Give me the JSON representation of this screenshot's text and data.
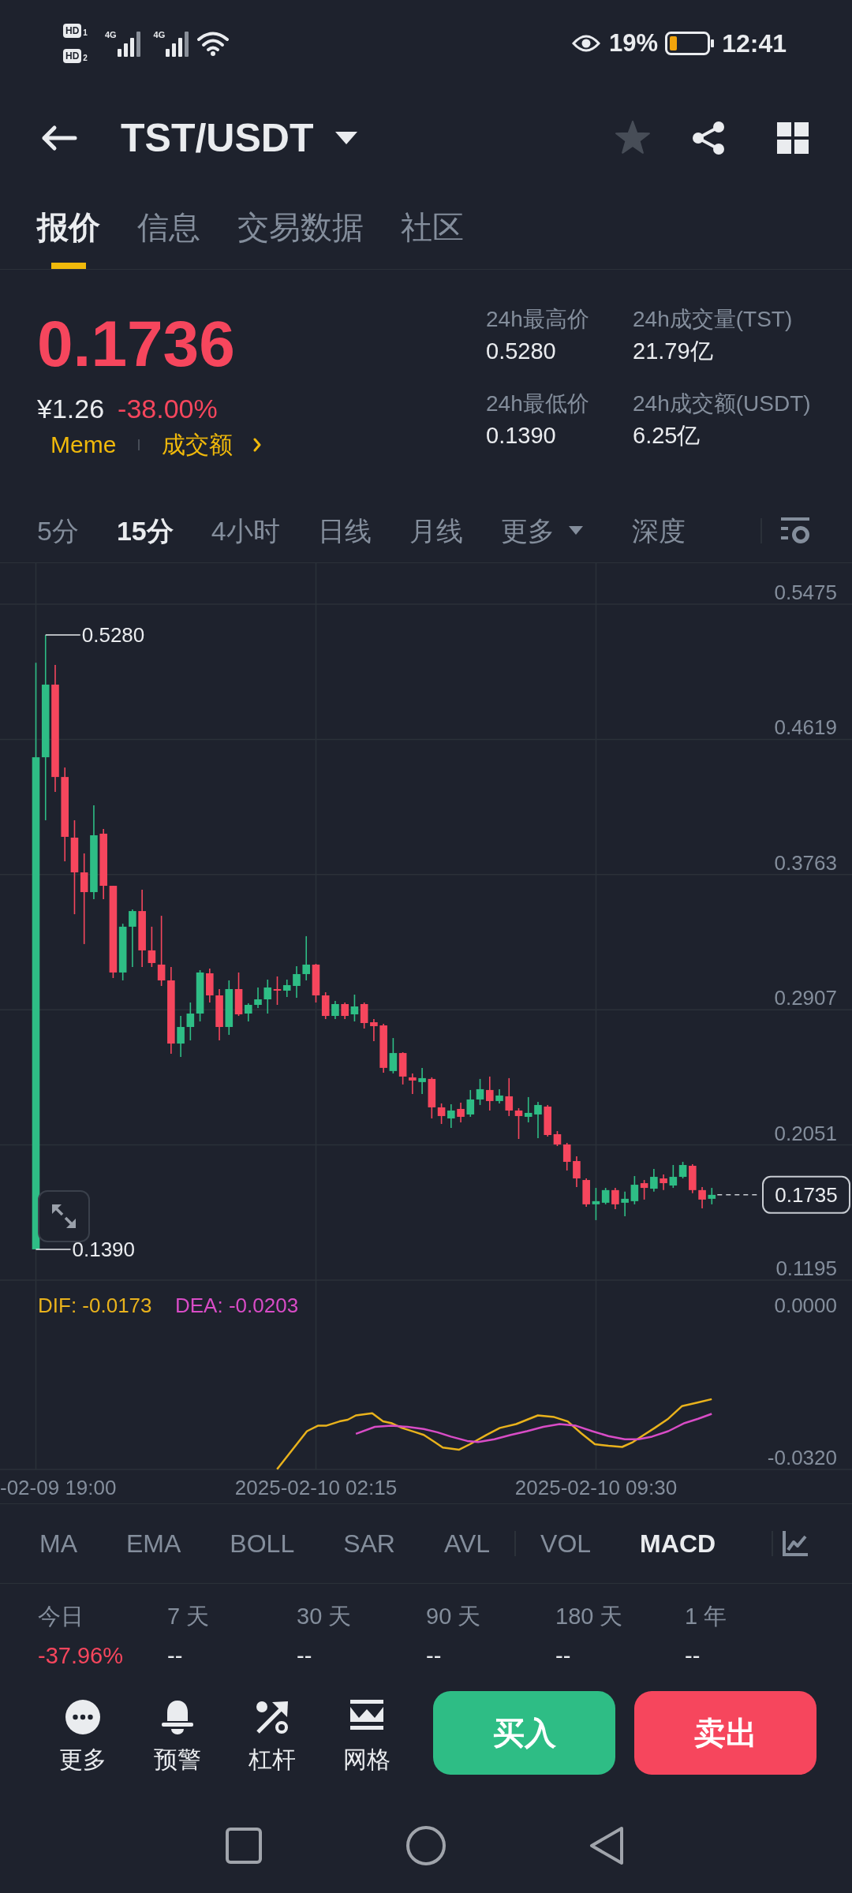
{
  "status_bar": {
    "hd_badges": [
      {
        "label": "HD",
        "sim": "1"
      },
      {
        "label": "HD",
        "sim": "2"
      }
    ],
    "networks": [
      {
        "type": "4G"
      },
      {
        "type": "4G"
      }
    ],
    "battery": "19%",
    "time": "12:41"
  },
  "header": {
    "pair": "TST/USDT",
    "favorite": false
  },
  "tabs": [
    {
      "label": "报价",
      "selected": true
    },
    {
      "label": "信息",
      "selected": false
    },
    {
      "label": "交易数据",
      "selected": false
    },
    {
      "label": "社区",
      "selected": false
    }
  ],
  "quote": {
    "price": "0.1736",
    "negative": true,
    "fiat_price": "¥1.26",
    "change": "-38.00%",
    "tags": [
      {
        "label": "Meme"
      },
      {
        "label": "成交额"
      }
    ],
    "stats": [
      {
        "label": "24h最高价",
        "value": "0.5280"
      },
      {
        "label": "24h成交量(TST)",
        "value": "21.79亿"
      },
      {
        "label": "24h最低价",
        "value": "0.1390"
      },
      {
        "label": "24h成交额(USDT)",
        "value": "6.25亿"
      }
    ]
  },
  "intervals": [
    {
      "label": "5分",
      "kind": "interval",
      "selected": false
    },
    {
      "label": "15分",
      "kind": "interval",
      "selected": true
    },
    {
      "label": "4小时",
      "kind": "interval",
      "selected": false
    },
    {
      "label": "日线",
      "kind": "interval",
      "selected": false
    },
    {
      "label": "月线",
      "kind": "interval",
      "selected": false
    },
    {
      "label": "更多",
      "kind": "dropdown",
      "selected": false
    },
    {
      "label": "深度",
      "kind": "view",
      "selected": false
    }
  ],
  "chart": {
    "chart_data": {
      "type": "candlestick",
      "grid": true,
      "categories": [
        null,
        null,
        null,
        null,
        null,
        null,
        null,
        null,
        null,
        null,
        null,
        null,
        null,
        null,
        null,
        null,
        null,
        null,
        null,
        null,
        null,
        null,
        null,
        null,
        null,
        null,
        null,
        null,
        null,
        null,
        null,
        null,
        null,
        null,
        null,
        null,
        null,
        null,
        null,
        null,
        null,
        null,
        null,
        null,
        null,
        null,
        null,
        null,
        null,
        null,
        null,
        null,
        null,
        null,
        null,
        null,
        null,
        null,
        null,
        null,
        null,
        null,
        null,
        null,
        null,
        null,
        null,
        null,
        null,
        null,
        null
      ],
      "ohlc": [
        [
          0.139,
          0.5105,
          0.139,
          0.4506
        ],
        [
          0.4506,
          0.528,
          0.4107,
          0.4966
        ],
        [
          0.4966,
          0.5091,
          0.4286,
          0.4381
        ],
        [
          0.4381,
          0.4441,
          0.3847,
          0.4002
        ],
        [
          0.3997,
          0.4107,
          0.3512,
          0.3777
        ],
        [
          0.3777,
          0.3897,
          0.3323,
          0.3652
        ],
        [
          0.3652,
          0.4202,
          0.3607,
          0.4012
        ],
        [
          0.4022,
          0.4052,
          0.3607,
          0.3692
        ],
        [
          0.3692,
          0.3692,
          0.3108,
          0.3143
        ],
        [
          0.3143,
          0.3452,
          0.3093,
          0.3433
        ],
        [
          0.3433,
          0.3542,
          0.3178,
          0.3532
        ],
        [
          0.3532,
          0.3667,
          0.3178,
          0.3283
        ],
        [
          0.3283,
          0.3433,
          0.3178,
          0.3203
        ],
        [
          0.3193,
          0.3502,
          0.3058,
          0.3093
        ],
        [
          0.3093,
          0.3178,
          0.2628,
          0.2693
        ],
        [
          0.2693,
          0.2868,
          0.2608,
          0.2798
        ],
        [
          0.2798,
          0.2953,
          0.2713,
          0.2883
        ],
        [
          0.2883,
          0.3158,
          0.2833,
          0.3143
        ],
        [
          0.3138,
          0.3168,
          0.2953,
          0.2998
        ],
        [
          0.2998,
          0.3038,
          0.2713,
          0.2798
        ],
        [
          0.2798,
          0.3093,
          0.2748,
          0.3038
        ],
        [
          0.3038,
          0.3143,
          0.2868,
          0.2878
        ],
        [
          0.2883,
          0.2948,
          0.2833,
          0.2938
        ],
        [
          0.2938,
          0.3048,
          0.2918,
          0.2973
        ],
        [
          0.2973,
          0.3098,
          0.2883,
          0.3048
        ],
        [
          0.3038,
          0.3118,
          0.2938,
          0.3028
        ],
        [
          0.3028,
          0.3098,
          0.2988,
          0.3063
        ],
        [
          0.3058,
          0.3183,
          0.2983,
          0.3133
        ],
        [
          0.3133,
          0.3373,
          0.3093,
          0.3193
        ],
        [
          0.3193,
          0.3198,
          0.2953,
          0.2998
        ],
        [
          0.2998,
          0.3018,
          0.2848,
          0.2868
        ],
        [
          0.2868,
          0.2963,
          0.2848,
          0.2943
        ],
        [
          0.2943,
          0.2953,
          0.2848,
          0.2868
        ],
        [
          0.2878,
          0.3003,
          0.2833,
          0.2928
        ],
        [
          0.2943,
          0.2953,
          0.2788,
          0.2823
        ],
        [
          0.2828,
          0.2848,
          0.2708,
          0.2803
        ],
        [
          0.2808,
          0.2818,
          0.2509,
          0.2539
        ],
        [
          0.2519,
          0.2728,
          0.2504,
          0.2633
        ],
        [
          0.2633,
          0.2638,
          0.2434,
          0.2484
        ],
        [
          0.2479,
          0.2504,
          0.2374,
          0.2459
        ],
        [
          0.2449,
          0.2539,
          0.2374,
          0.2474
        ],
        [
          0.2469,
          0.2479,
          0.2219,
          0.2289
        ],
        [
          0.2289,
          0.2314,
          0.2184,
          0.2234
        ],
        [
          0.2219,
          0.2309,
          0.2159,
          0.2269
        ],
        [
          0.2279,
          0.2319,
          0.2194,
          0.2229
        ],
        [
          0.2244,
          0.2399,
          0.2229,
          0.2339
        ],
        [
          0.2339,
          0.2469,
          0.2304,
          0.2404
        ],
        [
          0.2399,
          0.2484,
          0.2269,
          0.2329
        ],
        [
          0.2329,
          0.2404,
          0.2314,
          0.2364
        ],
        [
          0.2359,
          0.2474,
          0.2234,
          0.2269
        ],
        [
          0.2269,
          0.2284,
          0.2089,
          0.2234
        ],
        [
          0.2229,
          0.2354,
          0.2194,
          0.2254
        ],
        [
          0.2244,
          0.2324,
          0.2094,
          0.2304
        ],
        [
          0.2294,
          0.2304,
          0.2104,
          0.2114
        ],
        [
          0.2119,
          0.2139,
          0.2044,
          0.2054
        ],
        [
          0.2054,
          0.2064,
          0.1889,
          0.1944
        ],
        [
          0.1949,
          0.1979,
          0.1784,
          0.1839
        ],
        [
          0.1829,
          0.1839,
          0.166,
          0.1675
        ],
        [
          0.1675,
          0.1779,
          0.1575,
          0.1695
        ],
        [
          0.1685,
          0.1779,
          0.1675,
          0.1765
        ],
        [
          0.1765,
          0.1779,
          0.1645,
          0.1675
        ],
        [
          0.1685,
          0.1755,
          0.16,
          0.171
        ],
        [
          0.1695,
          0.1854,
          0.1675,
          0.1799
        ],
        [
          0.1809,
          0.1829,
          0.1705,
          0.1779
        ],
        [
          0.1774,
          0.1899,
          0.1755,
          0.1849
        ],
        [
          0.1839,
          0.1864,
          0.1765,
          0.1809
        ],
        [
          0.1794,
          0.1924,
          0.1779,
          0.1849
        ],
        [
          0.1849,
          0.1944,
          0.1839,
          0.1924
        ],
        [
          0.1919,
          0.1929,
          0.1745,
          0.1765
        ],
        [
          0.1765,
          0.1784,
          0.165,
          0.1705
        ],
        [
          0.171,
          0.1779,
          0.1675,
          0.1735
        ]
      ],
      "ylim": [
        0.1115,
        0.5735
      ],
      "yticks": [
        {
          "value": 0.5475,
          "label": "0.5475"
        },
        {
          "value": 0.4619,
          "label": "0.4619"
        },
        {
          "value": 0.3763,
          "label": "0.3763"
        },
        {
          "value": 0.2907,
          "label": "0.2907"
        },
        {
          "value": 0.2051,
          "label": "0.2051"
        },
        {
          "value": 0.1195,
          "label": "0.1195"
        }
      ]
    },
    "high_marker": "0.5280",
    "low_marker": "0.1390",
    "last_price": "0.1735",
    "macd_series": [
      {
        "label": "DIF: -0.0173",
        "color": "#e9b21c"
      },
      {
        "label": "DEA: -0.0203",
        "color": "#d84cc6"
      }
    ],
    "macd_ticks": [
      "0.0000",
      "-0.0320"
    ],
    "time_ticks": [
      "-02-09 19:00",
      "2025-02-10 02:15",
      "2025-02-10 09:30"
    ]
  },
  "indicators": {
    "main": [
      {
        "label": "MA",
        "selected": false
      },
      {
        "label": "EMA",
        "selected": false
      },
      {
        "label": "BOLL",
        "selected": false
      },
      {
        "label": "SAR",
        "selected": false
      },
      {
        "label": "AVL",
        "selected": false
      }
    ],
    "sub": [
      {
        "label": "VOL",
        "selected": false
      },
      {
        "label": "MACD",
        "selected": true
      }
    ]
  },
  "performance": [
    {
      "period": "今日",
      "value": "-37.96%",
      "negative": true
    },
    {
      "period": "7 天",
      "value": "--",
      "negative": false
    },
    {
      "period": "30 天",
      "value": "--",
      "negative": false
    },
    {
      "period": "90 天",
      "value": "--",
      "negative": false
    },
    {
      "period": "180 天",
      "value": "--",
      "negative": false
    },
    {
      "period": "1 年",
      "value": "--",
      "negative": false
    }
  ],
  "actions": [
    {
      "label": "更多",
      "kind": "more"
    },
    {
      "label": "预警",
      "kind": "alert"
    },
    {
      "label": "杠杆",
      "kind": "leverage"
    },
    {
      "label": "网格",
      "kind": "grid"
    }
  ],
  "trade_buttons": [
    {
      "label": "买入",
      "kind": "buy"
    },
    {
      "label": "卖出",
      "kind": "sell"
    }
  ]
}
